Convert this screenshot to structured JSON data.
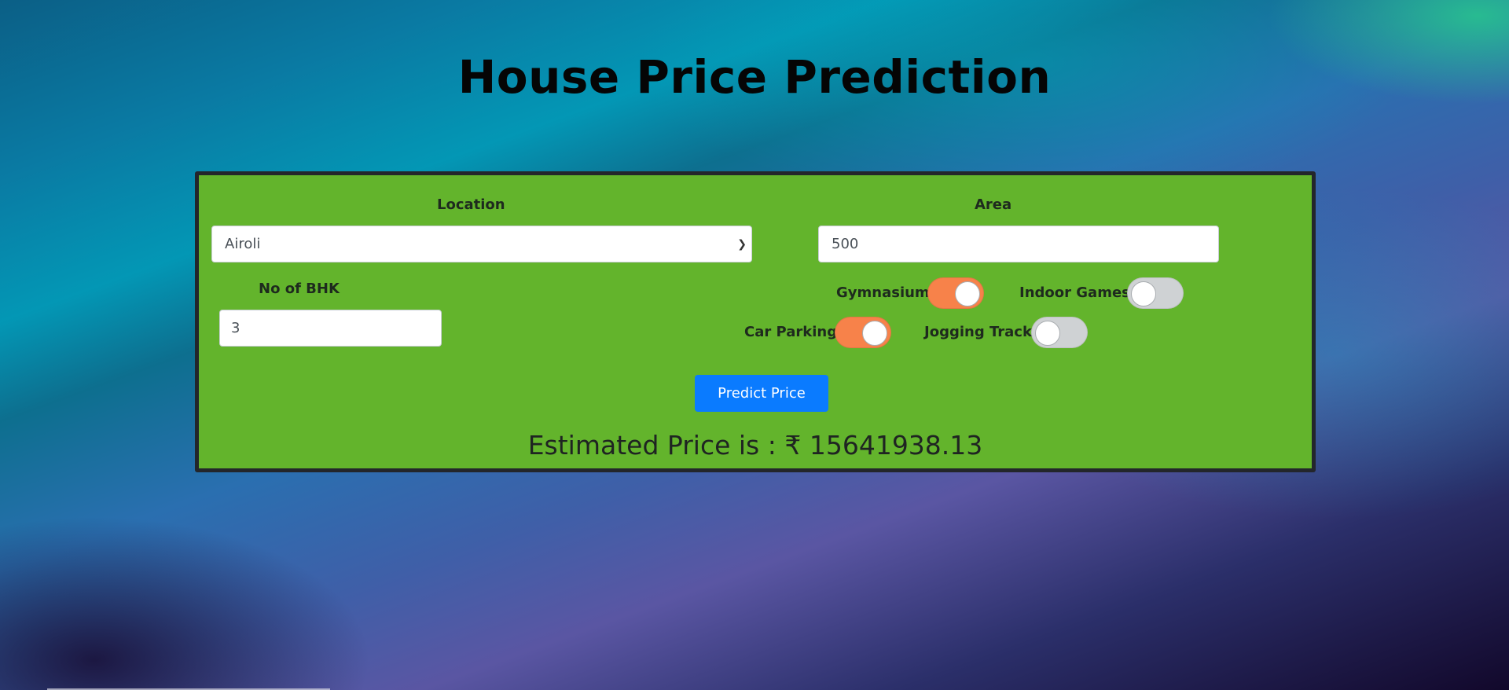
{
  "page": {
    "title": "House Price Prediction"
  },
  "form": {
    "location": {
      "label": "Location",
      "selected": "Airoli"
    },
    "area": {
      "label": "Area",
      "value": "500"
    },
    "bhk": {
      "label": "No of BHK",
      "value": "3"
    },
    "amenities": [
      {
        "label": "Gymnasium",
        "enabled": true
      },
      {
        "label": "Indoor Games",
        "enabled": false
      },
      {
        "label": "Car Parking",
        "enabled": true
      },
      {
        "label": "Jogging Track",
        "enabled": false
      }
    ],
    "predict_label": "Predict Price",
    "result_text": "Estimated Price is : ₹ 15641938.13"
  },
  "colors": {
    "card_bg": "#63b42c",
    "card_border": "#23262b",
    "button_bg": "#0a7bff",
    "toggle_on": "#f7824a",
    "toggle_off": "#cfd2d4"
  },
  "icons": {
    "select_arrow": "chevron-down-icon"
  }
}
